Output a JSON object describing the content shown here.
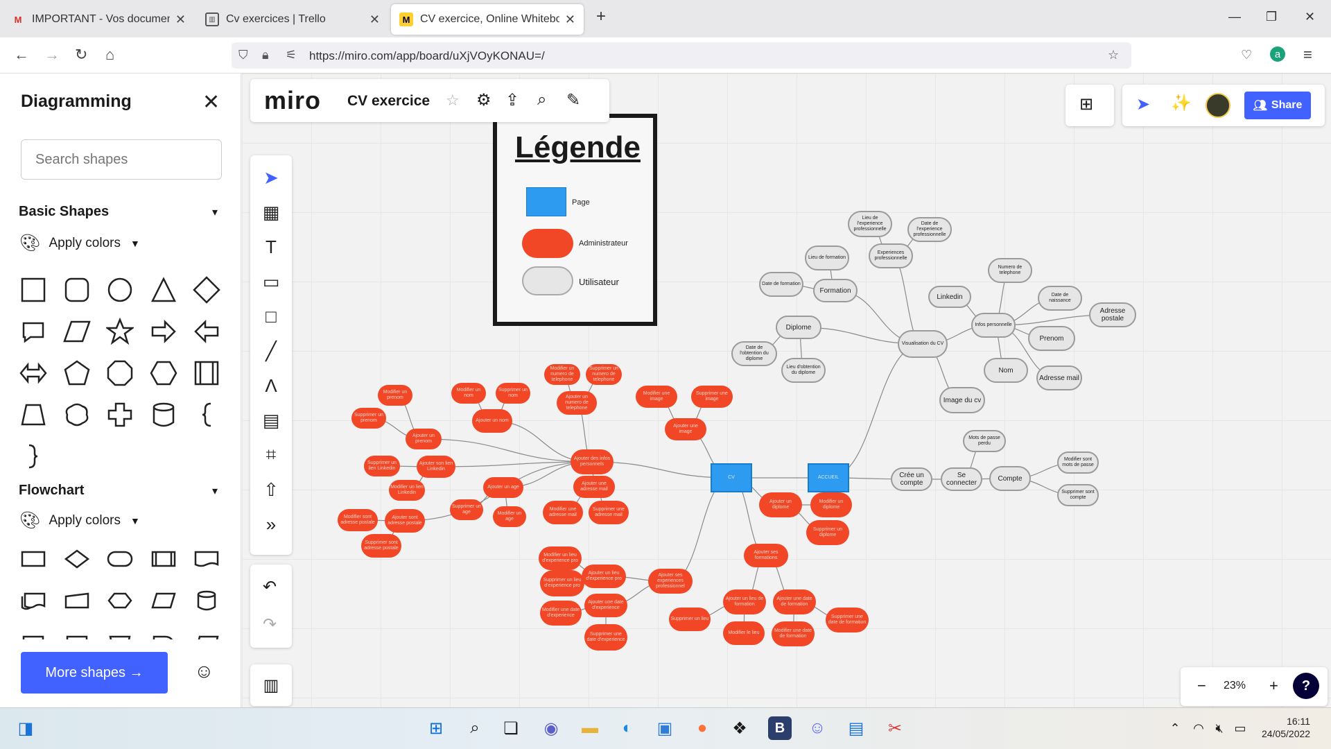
{
  "browser": {
    "tabs": [
      {
        "title": "IMPORTANT - Vos documents",
        "icon": "gmail-icon"
      },
      {
        "title": "Cv exercices | Trello",
        "icon": "trello-icon"
      },
      {
        "title": "CV exercice, Online Whiteboard",
        "icon": "miro-icon"
      }
    ],
    "new_tab": "+",
    "url": "https://miro.com/app/board/uXjVOyKONAU=/"
  },
  "panel": {
    "title": "Diagramming",
    "search_placeholder": "Search shapes",
    "sections": [
      {
        "title": "Basic Shapes",
        "apply": "Apply colors"
      },
      {
        "title": "Flowchart",
        "apply": "Apply colors"
      }
    ],
    "more_shapes": "More shapes →"
  },
  "board": {
    "logo": "miro",
    "name": "CV exercice",
    "share": "Share",
    "zoom": "23%"
  },
  "legend": {
    "title": "Légende",
    "items": [
      {
        "label": "Page",
        "color": "#2d9bf0"
      },
      {
        "label": "Administrateur",
        "color": "#f24726"
      },
      {
        "label": "Utilisateur",
        "color": "#e6e6e6"
      }
    ]
  },
  "mindmap": {
    "page_nodes": [
      "CV",
      "ACCUEIL"
    ],
    "user_nodes": [
      "Lieu de formation",
      "Date de formation",
      "Formation",
      "Lieu de l'experience professionnelle",
      "Date de l'experience professionnelle",
      "Experiences professionnelle",
      "Numero de telephone",
      "Linkedin",
      "Date de naissance",
      "Adresse postale",
      "Infos personnelle",
      "Prenom",
      "Diplome",
      "Visualisation du CV",
      "Date de l'obtention du diplome",
      "Lieu d'obtention du diplome",
      "Nom",
      "Adresse mail",
      "Image du cv",
      "Mots de passe perdu",
      "Modifier sont mots de passe",
      "Crée un compte",
      "Se connecter",
      "Compte",
      "Supprimer sont compte"
    ],
    "admin_nodes": [
      "Modifier un prenom",
      "Supprimer un prenom",
      "Ajouter un prenom",
      "Modifier un nom",
      "Supprimer un nom",
      "Ajouter un nom",
      "Modifier un numero de telephone",
      "Supprimer un numero de telephone",
      "Ajouter un numero de telephone",
      "Modifier une image",
      "Supprimer une image",
      "Ajouter une image",
      "Ajouter des infos personnels",
      "Supprimer un lien Linkedin",
      "Ajouter son lien Linkedin",
      "Modifier un lien Linkedin",
      "Ajouter un age",
      "Supprimer un age",
      "Modifier un age",
      "Ajouter une adresse mail",
      "Modifier une adresse mail",
      "Supprimer une adresse mail",
      "Modifier sont adresse postale",
      "Ajouter sont adresse postale",
      "Supprimer sont adresse postale",
      "Ajouter un diplome",
      "Modifier un diplome",
      "Supprimer un diplome",
      "Ajouter ses formations",
      "Modifier un lieu d'experience pro",
      "Ajouter un lieu d'experience pro",
      "Supprimer un lieu d'experience pro",
      "Ajouter ses experiences professionnel",
      "Modifier une date d'experience",
      "Ajouter une date d'experience",
      "Supprimer une date d'experience",
      "Supprimer un lieu",
      "Ajouter un lieu de formation",
      "Ajouter une date de formation",
      "Modifier le lieu",
      "Modifier une date de formation",
      "Supprimer une date de formation"
    ]
  },
  "taskbar": {
    "time": "16:11",
    "date": "24/05/2022"
  }
}
